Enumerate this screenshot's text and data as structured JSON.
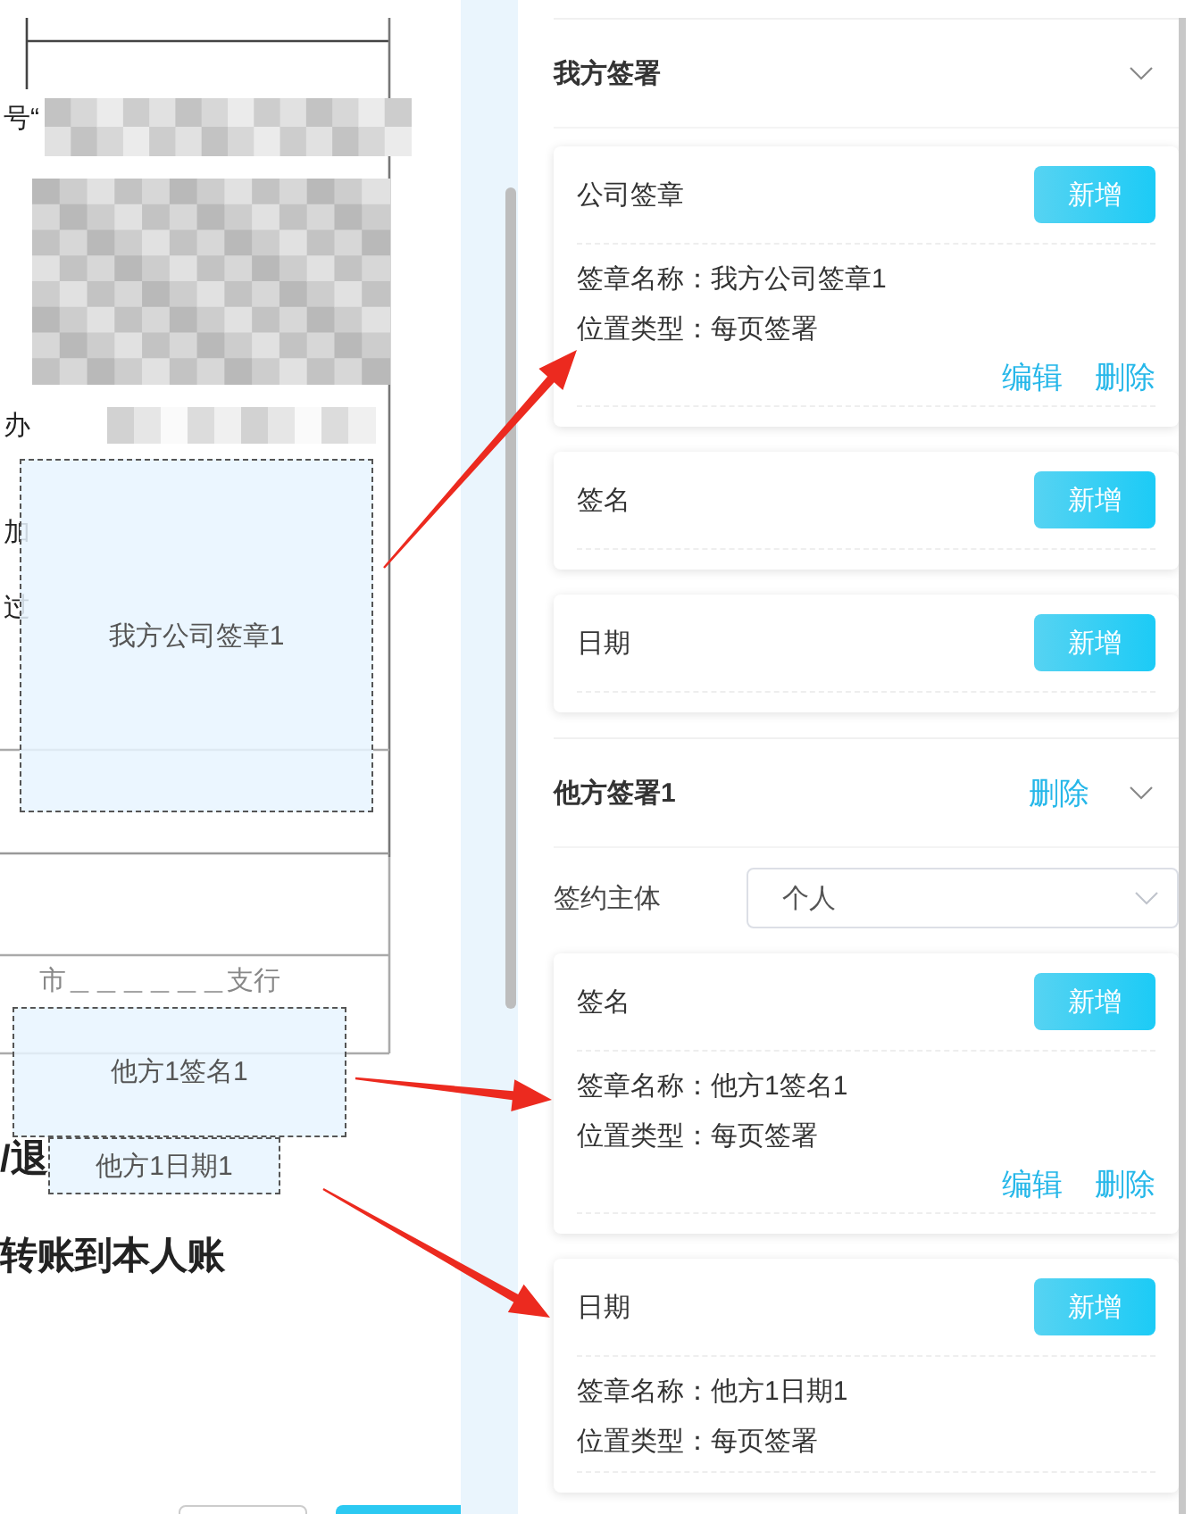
{
  "document": {
    "lines": [
      {
        "text": "号“",
        "kind": "normal"
      },
      {
        "text": "办",
        "kind": "normal"
      },
      {
        "text": "加",
        "kind": "normal"
      },
      {
        "text": "过",
        "kind": "normal"
      },
      {
        "text": "市＿＿＿＿＿＿支行",
        "kind": "faint"
      },
      {
        "text": "/退",
        "kind": "bold"
      },
      {
        "text": "转账到本人账",
        "kind": "bold"
      }
    ]
  },
  "placed_stamps": [
    {
      "label": "我方公司签章1"
    },
    {
      "label": "他方1签名1"
    },
    {
      "label": "他方1日期1"
    }
  ],
  "panel": {
    "sections": [
      {
        "title": "我方签署",
        "expanded": true,
        "cards": [
          {
            "title": "公司签章",
            "add_button": "新增",
            "entries": [
              {
                "lines": [
                  "签章名称：我方公司签章1",
                  "位置类型：每页签署"
                ],
                "actions": [
                  "编辑",
                  "删除"
                ]
              }
            ]
          },
          {
            "title": "签名",
            "add_button": "新增"
          },
          {
            "title": "日期",
            "add_button": "新增"
          }
        ]
      },
      {
        "title": "他方签署1",
        "delete_link": "删除",
        "expanded": true,
        "field": {
          "label": "签约主体",
          "value": "个人"
        },
        "cards": [
          {
            "title": "签名",
            "add_button": "新增",
            "entries": [
              {
                "lines": [
                  "签章名称：他方1签名1",
                  "位置类型：每页签署"
                ],
                "actions": [
                  "编辑",
                  "删除"
                ]
              }
            ]
          },
          {
            "title": "日期",
            "add_button": "新增",
            "entries": [
              {
                "lines": [
                  "签章名称：他方1日期1",
                  "位置类型：每页签署"
                ]
              }
            ]
          }
        ]
      }
    ]
  }
}
